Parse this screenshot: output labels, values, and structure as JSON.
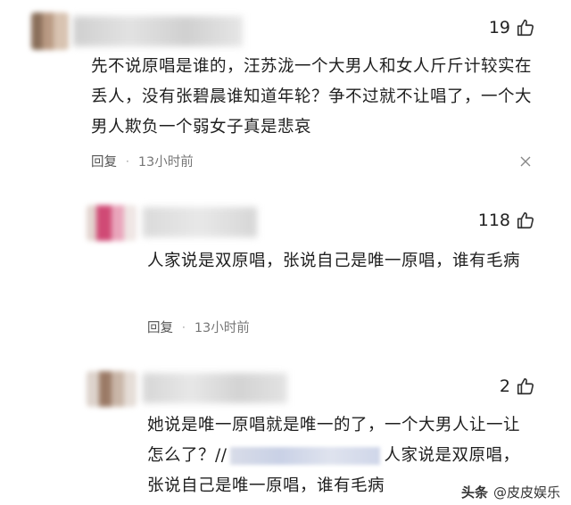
{
  "comments": [
    {
      "likes": "19",
      "text": "先不说原唱是谁的，汪苏泷一个大男人和女人斤斤计较实在丢人，没有张碧晨谁知道年轮？争不过就不让唱了，一个大男人欺负一个弱女子真是悲哀",
      "reply_label": "回复",
      "time": "13小时前"
    },
    {
      "likes": "118",
      "text": "人家说是双原唱，张说自己是唯一原唱，谁有毛病",
      "reply_label": "回复",
      "time": "13小时前"
    },
    {
      "likes": "2",
      "text_before": "她说是唯一原唱就是唯一的了，一个大男人让一让怎么了？//",
      "text_after": "人家说是双原唱，张说自己是唯一原唱，谁有毛病"
    }
  ],
  "watermark": {
    "prefix": "头条",
    "account": "@皮皮娱乐"
  },
  "colors": {
    "background": "#ffffff",
    "text": "#1f1f1f",
    "meta": "#777777"
  }
}
